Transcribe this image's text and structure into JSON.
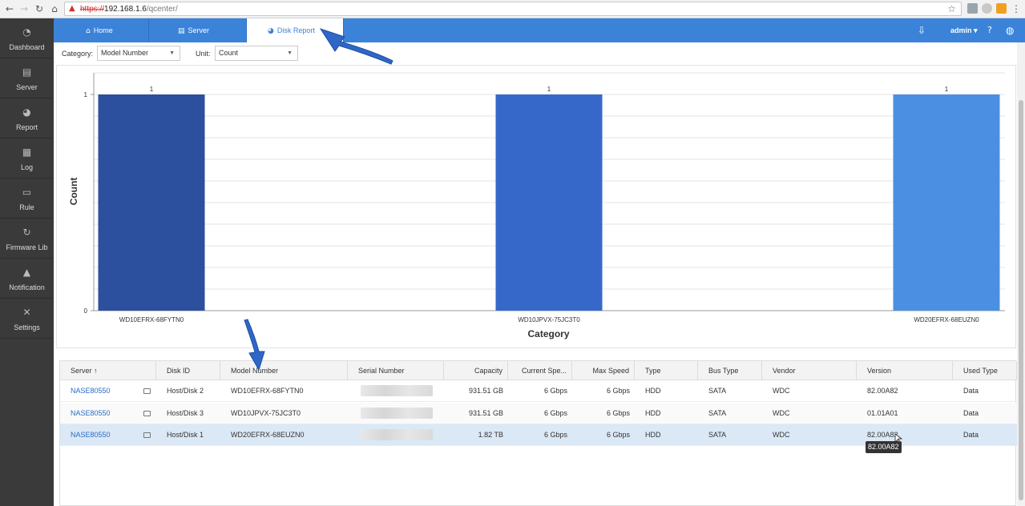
{
  "browser": {
    "url_protocol": "https://",
    "url_host": "192.168.1.6",
    "url_path": "/qcenter/"
  },
  "sidebar": {
    "items": [
      {
        "label": "Dashboard",
        "icon": "gauge-icon"
      },
      {
        "label": "Server",
        "icon": "server-icon"
      },
      {
        "label": "Report",
        "icon": "pie-chart-icon"
      },
      {
        "label": "Log",
        "icon": "log-icon"
      },
      {
        "label": "Rule",
        "icon": "book-icon"
      },
      {
        "label": "Firmware Lib",
        "icon": "refresh-icon"
      },
      {
        "label": "Notification",
        "icon": "bell-icon"
      },
      {
        "label": "Settings",
        "icon": "tools-icon"
      }
    ]
  },
  "topnav": {
    "tabs": [
      {
        "label": "Home",
        "icon": "home-icon"
      },
      {
        "label": "Server",
        "icon": "server-icon"
      },
      {
        "label": "Disk Report",
        "icon": "pie-chart-icon"
      }
    ],
    "active_tab": "Disk Report",
    "user": "admin",
    "accent": "#3b83d9"
  },
  "filters": {
    "category_label": "Category:",
    "category_value": "Model Number",
    "unit_label": "Unit:",
    "unit_value": "Count"
  },
  "chart_data": {
    "type": "bar",
    "categories": [
      "WD10EFRX-68FYTN0",
      "WD10JPVX-75JC3T0",
      "WD20EFRX-68EUZN0"
    ],
    "values": [
      1,
      1,
      1
    ],
    "colors": [
      "#2c4f9e",
      "#3568c9",
      "#4b8fe2"
    ],
    "xlabel": "Category",
    "ylabel": "Count",
    "ylim": [
      0,
      1
    ],
    "yticks": [
      0,
      1
    ],
    "grid": true
  },
  "table": {
    "columns": [
      "Server ↑",
      "Disk ID",
      "Model Number",
      "Serial Number",
      "Capacity",
      "Current Spe...",
      "Max Speed",
      "Type",
      "Bus Type",
      "Vendor",
      "Version",
      "Used Type"
    ],
    "rows": [
      [
        "NASE80550",
        "Host/Disk 2",
        "WD10EFRX-68FYTN0",
        "",
        "931.51 GB",
        "6 Gbps",
        "6 Gbps",
        "HDD",
        "SATA",
        "WDC",
        "82.00A82",
        "Data"
      ],
      [
        "NASE80550",
        "Host/Disk 3",
        "WD10JPVX-75JC3T0",
        "",
        "931.51 GB",
        "6 Gbps",
        "6 Gbps",
        "HDD",
        "SATA",
        "WDC",
        "01.01A01",
        "Data"
      ],
      [
        "NASE80550",
        "Host/Disk 1",
        "WD20EFRX-68EUZN0",
        "",
        "1.82 TB",
        "6 Gbps",
        "6 Gbps",
        "HDD",
        "SATA",
        "WDC",
        "82.00A82",
        "Data"
      ]
    ],
    "selected_row": 2,
    "tooltip": "82.00A82"
  }
}
